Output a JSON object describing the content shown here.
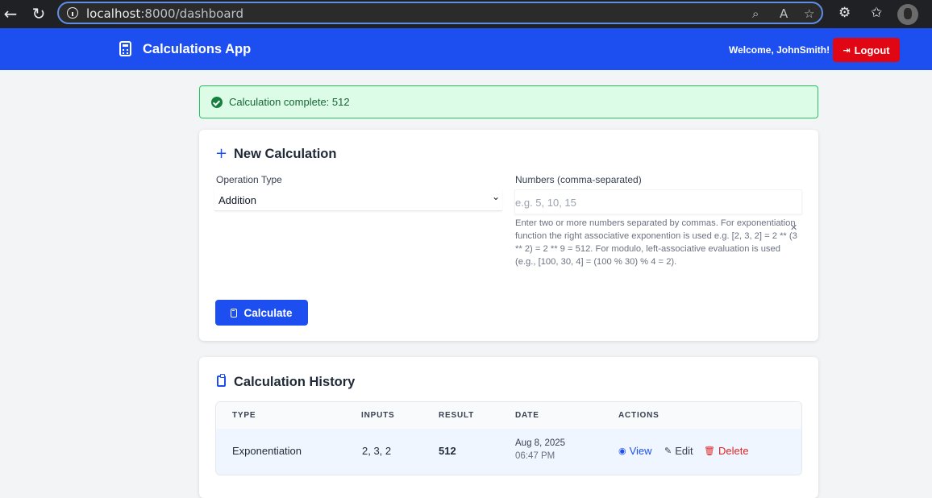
{
  "browser": {
    "url_host": "localhost",
    "url_path": ":8000/dashboard"
  },
  "navbar": {
    "brand": "Calculations App",
    "welcome": "Welcome, JohnSmith!",
    "logout_label": "Logout",
    "color": "#1d4ff0"
  },
  "alert": {
    "message": "Calculation complete: 512",
    "color": "#166534"
  },
  "new_calc": {
    "title": "New Calculation",
    "operation_label": "Operation Type",
    "operation_value": "Addition",
    "numbers_label": "Numbers (comma-separated)",
    "numbers_value": "",
    "numbers_placeholder": "e.g. 5, 10, 15",
    "help_text": "Enter two or more numbers separated by commas. For exponentiation function the right associative exponention is used e.g. [2, 3, 2] = 2 ** (3 ** 2) = 2 ** 9 = 512. For modulo, left-associative evaluation is used (e.g., [100, 30, 4] = (100 % 30) % 4 = 2).",
    "calculate_label": "Calculate"
  },
  "history": {
    "title": "Calculation History",
    "columns": [
      "TYPE",
      "INPUTS",
      "RESULT",
      "DATE",
      "ACTIONS"
    ],
    "rows": [
      {
        "type": "Exponentiation",
        "inputs": "2, 3, 2",
        "result": "512",
        "date": "Aug 8, 2025",
        "time": "06:47 PM",
        "view": "View",
        "edit": "Edit",
        "delete": "Delete"
      }
    ]
  }
}
